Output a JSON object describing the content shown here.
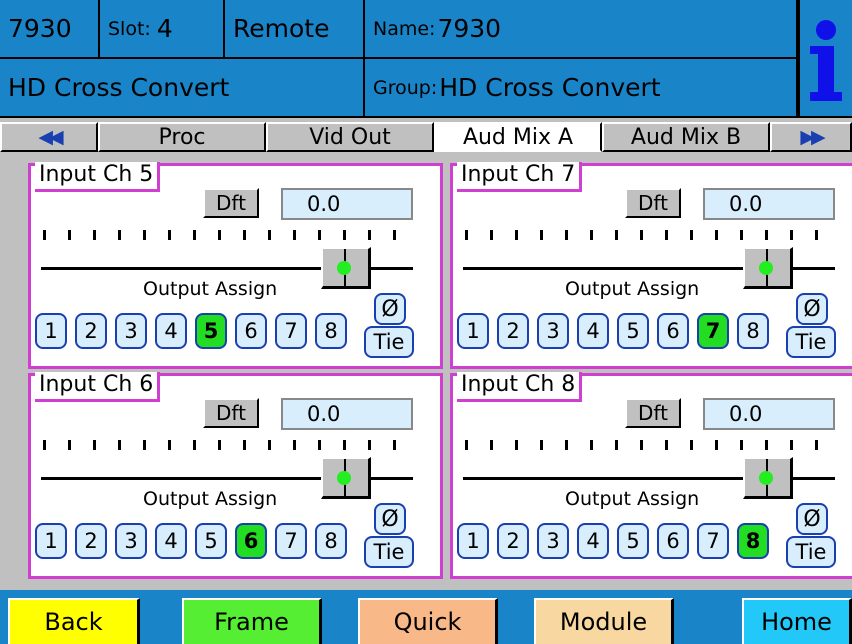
{
  "header": {
    "model": "7930",
    "slot_label": "Slot:",
    "slot_value": "4",
    "mode": "Remote",
    "name_label": "Name:",
    "name_value": "7930",
    "product": "HD Cross Convert",
    "group_label": "Group:",
    "group_value": "HD Cross Convert"
  },
  "tabs": {
    "prev_icon": "double-left-arrow-icon",
    "next_icon": "double-right-arrow-icon",
    "items": [
      {
        "label": "Proc",
        "active": false
      },
      {
        "label": "Vid Out",
        "active": false
      },
      {
        "label": "Aud Mix A",
        "active": true
      },
      {
        "label": "Aud Mix B",
        "active": false
      }
    ]
  },
  "panels": [
    {
      "title": "Input Ch 5",
      "default_label": "Dft",
      "value": "0.0",
      "output_assign_label": "Output Assign",
      "buttons": [
        "1",
        "2",
        "3",
        "4",
        "5",
        "6",
        "7",
        "8"
      ],
      "selected": "5",
      "phase_label": "Ø",
      "tie_label": "Tie"
    },
    {
      "title": "Input Ch 7",
      "default_label": "Dft",
      "value": "0.0",
      "output_assign_label": "Output Assign",
      "buttons": [
        "1",
        "2",
        "3",
        "4",
        "5",
        "6",
        "7",
        "8"
      ],
      "selected": "7",
      "phase_label": "Ø",
      "tie_label": "Tie"
    },
    {
      "title": "Input Ch 6",
      "default_label": "Dft",
      "value": "0.0",
      "output_assign_label": "Output Assign",
      "buttons": [
        "1",
        "2",
        "3",
        "4",
        "5",
        "6",
        "7",
        "8"
      ],
      "selected": "6",
      "phase_label": "Ø",
      "tie_label": "Tie"
    },
    {
      "title": "Input Ch 8",
      "default_label": "Dft",
      "value": "0.0",
      "output_assign_label": "Output Assign",
      "buttons": [
        "1",
        "2",
        "3",
        "4",
        "5",
        "6",
        "7",
        "8"
      ],
      "selected": "8",
      "phase_label": "Ø",
      "tie_label": "Tie"
    }
  ],
  "footer": {
    "back": "Back",
    "frame": "Frame",
    "quick": "Quick",
    "module": "Module",
    "home": "Home"
  },
  "colors": {
    "header_bg": "#1a84c8",
    "panel_border": "#d040d0",
    "selected_button": "#22dd22",
    "back_button": "#ffff00",
    "frame_button": "#55ee33",
    "quick_button": "#f8b888",
    "module_button": "#f8d8a0",
    "home_button": "#22c8f8"
  }
}
